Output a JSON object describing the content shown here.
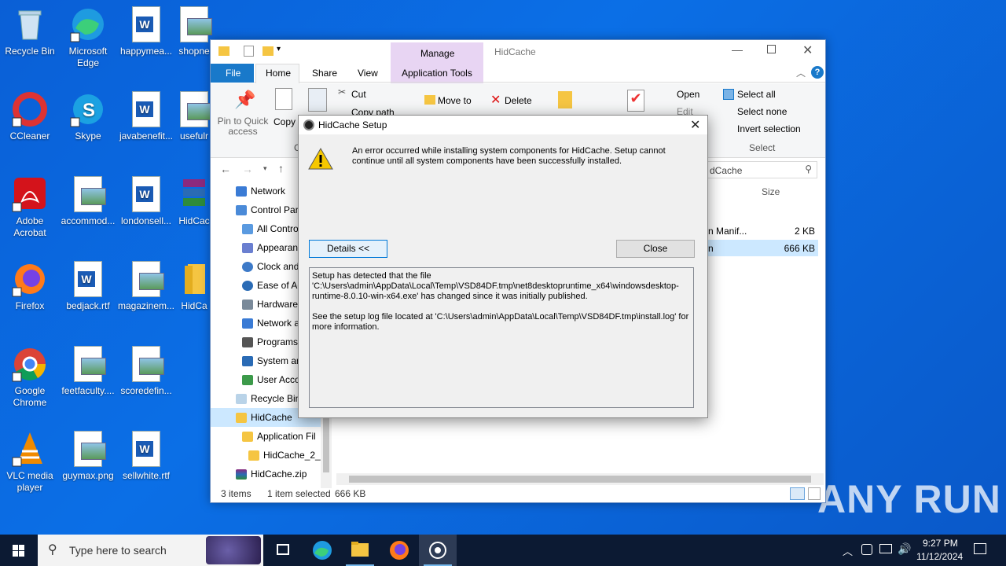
{
  "desktop": {
    "icons": [
      {
        "label": "Recycle Bin"
      },
      {
        "label": "Microsoft Edge"
      },
      {
        "label": "happymea..."
      },
      {
        "label": "shopne"
      },
      {
        "label": "CCleaner"
      },
      {
        "label": "Skype"
      },
      {
        "label": "javabenefit..."
      },
      {
        "label": "usefulr"
      },
      {
        "label": "Adobe Acrobat"
      },
      {
        "label": "accommod..."
      },
      {
        "label": "londonsell..."
      },
      {
        "label": "HidCac"
      },
      {
        "label": "Firefox"
      },
      {
        "label": "bedjack.rtf"
      },
      {
        "label": "magazinem..."
      },
      {
        "label": "HidCa"
      },
      {
        "label": "Google Chrome"
      },
      {
        "label": "feetfaculty...."
      },
      {
        "label": "scoredefin..."
      },
      {
        "label": "VLC media player"
      },
      {
        "label": "guymax.png"
      },
      {
        "label": "sellwhite.rtf"
      }
    ]
  },
  "explorer": {
    "context_tab": "Manage",
    "title": "HidCache",
    "tabs": [
      "File",
      "Home",
      "Share",
      "View",
      "Application Tools"
    ],
    "ribbon": {
      "pin": "Pin to Quick access",
      "copy": "Copy",
      "cut": "Cut",
      "copy_path": "Copy path",
      "move_to": "Move to",
      "delete": "Delete",
      "open": "Open",
      "edit": "Edit",
      "select_all": "Select all",
      "select_none": "Select none",
      "invert_selection": "Invert selection",
      "select_group": "Select",
      "clip_fragment": "C"
    },
    "search_fragment": "dCache",
    "column_size": "Size",
    "files": [
      {
        "name": "n Manif...",
        "size": "2 KB"
      },
      {
        "name": "n",
        "size": "666 KB"
      }
    ],
    "nav": [
      {
        "label": "Network"
      },
      {
        "label": "Control Par"
      },
      {
        "label": "All Contro"
      },
      {
        "label": "Appearan"
      },
      {
        "label": "Clock and"
      },
      {
        "label": "Ease of Ac"
      },
      {
        "label": "Hardware"
      },
      {
        "label": "Network a"
      },
      {
        "label": "Programs"
      },
      {
        "label": "System an"
      },
      {
        "label": "User Acco"
      },
      {
        "label": "Recycle Bin"
      },
      {
        "label": "HidCache"
      },
      {
        "label": "Application Fil"
      },
      {
        "label": "HidCache_2_"
      },
      {
        "label": "HidCache.zip"
      }
    ],
    "status": {
      "items": "3 items",
      "selected": "1 item selected",
      "size": "666 KB"
    }
  },
  "dialog": {
    "title": "HidCache Setup",
    "message": "An error occurred while installing system components for HidCache. Setup cannot continue until all system components have been successfully installed.",
    "details_button": "Details <<",
    "close_button": "Close",
    "details_p1": "Setup has detected that the file 'C:\\Users\\admin\\AppData\\Local\\Temp\\VSD84DF.tmp\\net8desktopruntime_x64\\windowsdesktop-runtime-8.0.10-win-x64.exe' has changed since it was initially published.",
    "details_p2": "See the setup log file located at 'C:\\Users\\admin\\AppData\\Local\\Temp\\VSD84DF.tmp\\install.log' for more information."
  },
  "taskbar": {
    "search_placeholder": "Type here to search",
    "time": "9:27 PM",
    "date": "11/12/2024"
  },
  "watermark": "ANY RUN"
}
